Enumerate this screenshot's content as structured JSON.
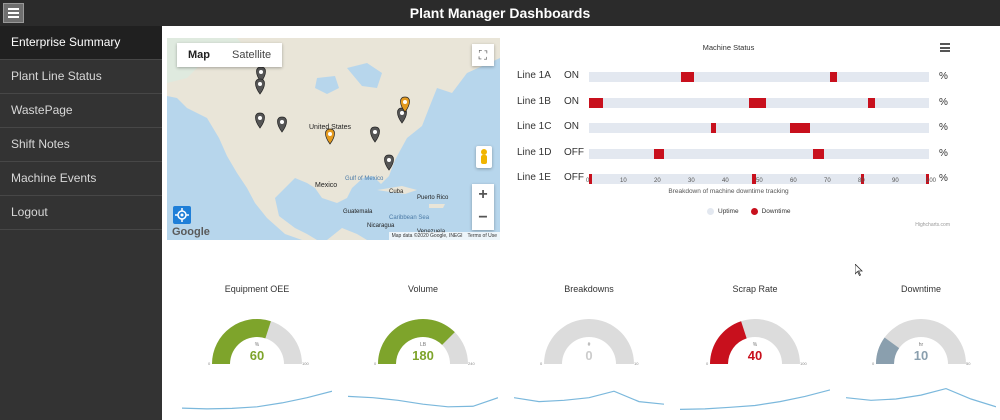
{
  "app": {
    "title": "Plant Manager Dashboards"
  },
  "sidebar": {
    "items": [
      {
        "label": "Enterprise Summary",
        "active": true
      },
      {
        "label": "Plant Line Status",
        "active": false
      },
      {
        "label": "WastePage",
        "active": false
      },
      {
        "label": "Shift Notes",
        "active": false
      },
      {
        "label": "Machine Events",
        "active": false
      },
      {
        "label": "Logout",
        "active": false
      }
    ]
  },
  "map": {
    "type_options": [
      "Map",
      "Satellite"
    ],
    "selected_type": "Map",
    "logo": "Google",
    "attribution": {
      "data": "Map data ©2020 Google, INEGI",
      "terms": "Terms of Use"
    },
    "labels": {
      "united_states": "United States",
      "mexico": "Mexico",
      "cuba": "Cuba",
      "gulf": "Gulf of Mexico",
      "guatemala": "Guatemala",
      "caribbean": "Caribbean Sea",
      "puerto_rico": "Puerto Rico",
      "nicaragua": "Nicaragua",
      "venezuela": "Venezuela"
    },
    "markers": [
      {
        "color": "#555555",
        "icon": "map-pin-icon"
      },
      {
        "color": "#555555",
        "icon": "map-pin-icon"
      },
      {
        "color": "#555555",
        "icon": "map-pin-icon"
      },
      {
        "color": "#555555",
        "icon": "map-pin-icon"
      },
      {
        "color": "#e39a1f",
        "icon": "map-pin-icon"
      },
      {
        "color": "#555555",
        "icon": "map-pin-icon"
      },
      {
        "color": "#e39a1f",
        "icon": "map-pin-icon"
      },
      {
        "color": "#555555",
        "icon": "map-pin-icon"
      },
      {
        "color": "#555555",
        "icon": "map-pin-icon"
      }
    ]
  },
  "chart_data": [
    {
      "type": "bar",
      "title": "Machine Status",
      "xlabel": "Breakdown of machine downtime tracking",
      "xlim": [
        0,
        100
      ],
      "xticks": [
        0,
        10,
        20,
        30,
        40,
        50,
        60,
        70,
        80,
        90,
        100
      ],
      "unit": "%",
      "legend": [
        "Uptime",
        "Downtime"
      ],
      "legend_placement": "bottom",
      "colors": {
        "uptime": "#e3e8f0",
        "downtime": "#c8101d"
      },
      "credit": "Highcharts.com",
      "lines": [
        {
          "name": "Line 1A",
          "status": "ON",
          "downtime": [
            [
              27,
              31
            ],
            [
              71,
              73
            ]
          ]
        },
        {
          "name": "Line 1B",
          "status": "ON",
          "downtime": [
            [
              0,
              4
            ],
            [
              47,
              52
            ],
            [
              82,
              84
            ]
          ]
        },
        {
          "name": "Line 1C",
          "status": "ON",
          "downtime": [
            [
              36,
              37.5
            ],
            [
              59,
              65
            ]
          ]
        },
        {
          "name": "Line 1D",
          "status": "OFF",
          "downtime": [
            [
              19,
              22
            ],
            [
              66,
              69
            ]
          ]
        },
        {
          "name": "Line 1E",
          "status": "OFF",
          "downtime": [
            [
              0,
              1
            ],
            [
              48,
              49
            ],
            [
              80,
              81
            ],
            [
              99,
              100
            ]
          ]
        }
      ]
    }
  ],
  "gauges": [
    {
      "title": "Equipment OEE",
      "unit": "%",
      "value": "60",
      "fraction": 0.6,
      "color": "#7ea42b",
      "min": "0",
      "max": "100",
      "trend": [
        0.15,
        0.12,
        0.14,
        0.2,
        0.35,
        0.55,
        0.8
      ]
    },
    {
      "title": "Volume",
      "unit": "LB",
      "value": "180",
      "fraction": 0.75,
      "color": "#7ea42b",
      "min": "0",
      "max": "240",
      "trend": [
        0.6,
        0.55,
        0.45,
        0.3,
        0.2,
        0.22,
        0.55
      ]
    },
    {
      "title": "Breakdowns",
      "unit": "#",
      "value": "0",
      "fraction": 0.0,
      "color": "#cccccc",
      "min": "0",
      "max": "10",
      "trend": [
        0.55,
        0.4,
        0.45,
        0.55,
        0.8,
        0.4,
        0.3
      ]
    },
    {
      "title": "Scrap Rate",
      "unit": "%",
      "value": "40",
      "fraction": 0.4,
      "color": "#c8101d",
      "min": "0",
      "max": "100",
      "trend": [
        0.1,
        0.12,
        0.18,
        0.25,
        0.4,
        0.6,
        0.85
      ]
    },
    {
      "title": "Downtime",
      "unit": "hr",
      "value": "10",
      "fraction": 0.2,
      "color": "#8a9fae",
      "min": "0",
      "max": "50",
      "trend": [
        0.55,
        0.45,
        0.5,
        0.65,
        0.9,
        0.5,
        0.2
      ]
    }
  ]
}
